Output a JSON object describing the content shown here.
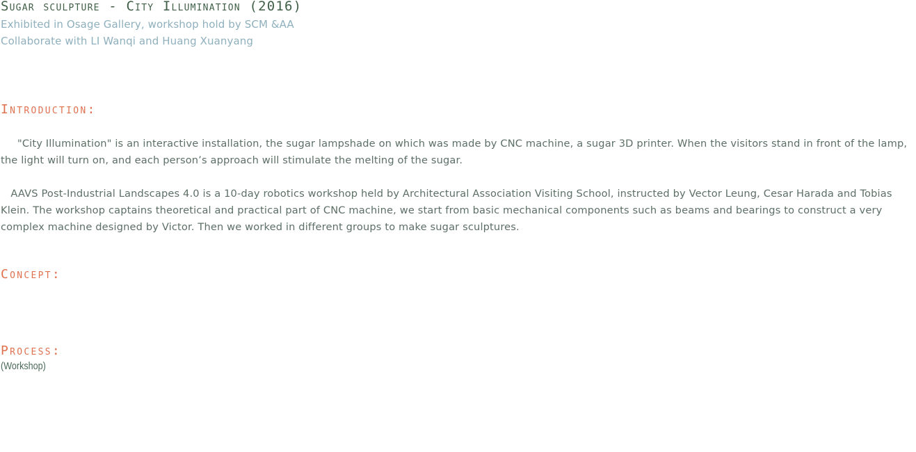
{
  "header": {
    "title": "Sugar sculpture - City Illumination (2016)",
    "subtitle_line1": "Exhibited in Osage Gallery, workshop hold by SCM &AA",
    "subtitle_line2": "Collaborate with LI Wanqi and Huang Xuanyang"
  },
  "introduction": {
    "heading": "Introduction:",
    "paragraph1": "     \"City Illumination\" is an interactive installation, the sugar lampshade on which was made by CNC machine, a sugar 3D printer. When the visitors stand in front of the lamp, the light will turn on, and each person’s approach will stimulate the melting of the sugar.",
    "paragraph2": "   AAVS Post-Industrial Landscapes 4.0 is a 10-day robotics workshop held by Architectural Association Visiting School, instructed by Vector Leung, Cesar Harada and Tobias Klein. The workshop captains theoretical and practical part of CNC machine, we start from basic mechanical components such as beams and bearings to construct a very complex machine designed by Victor. Then we worked in different groups to make sugar sculptures."
  },
  "concept": {
    "heading": "Concept:"
  },
  "process": {
    "heading": "Process:",
    "note": "(Workshop)"
  },
  "colors": {
    "title": "#3f5f46",
    "subtitle": "#8fb0bd",
    "heading_accent": "#e0714f",
    "body_text": "#5d6f66"
  }
}
